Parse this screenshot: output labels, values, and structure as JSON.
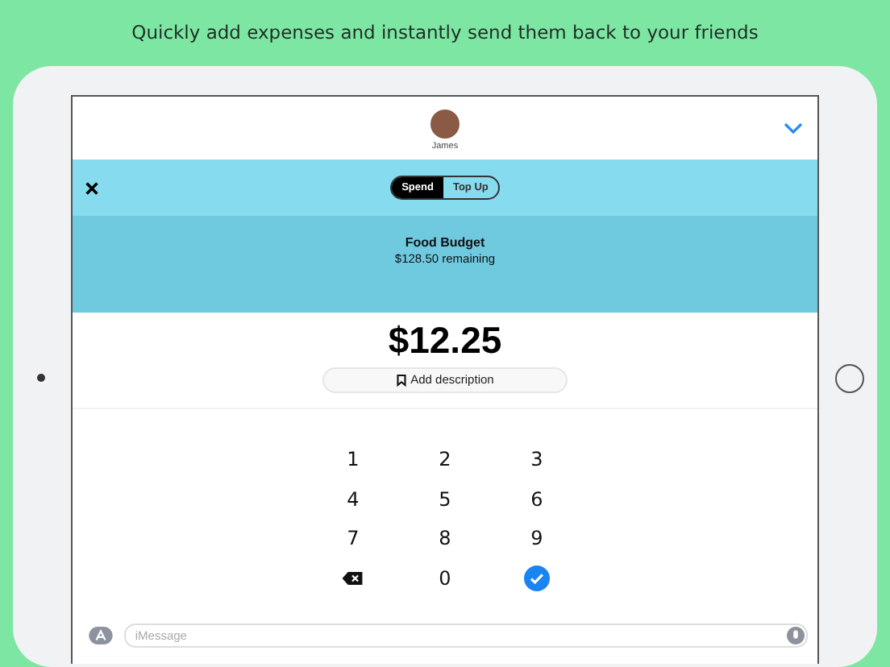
{
  "headline": "Quickly add expenses and instantly send them back to your friends",
  "contact": {
    "name": "James"
  },
  "segments": [
    {
      "label": "Spend",
      "selected": true
    },
    {
      "label": "Top Up",
      "selected": false
    }
  ],
  "budget": {
    "title": "Food Budget",
    "remaining": "$128.50 remaining"
  },
  "amount": "$12.25",
  "description": {
    "label": "Add description"
  },
  "keypad": [
    {
      "kind": "digit",
      "label": "1"
    },
    {
      "kind": "digit",
      "label": "2"
    },
    {
      "kind": "digit",
      "label": "3"
    },
    {
      "kind": "digit",
      "label": "4"
    },
    {
      "kind": "digit",
      "label": "5"
    },
    {
      "kind": "digit",
      "label": "6"
    },
    {
      "kind": "digit",
      "label": "7"
    },
    {
      "kind": "digit",
      "label": "8"
    },
    {
      "kind": "digit",
      "label": "9"
    },
    {
      "kind": "delete"
    },
    {
      "kind": "digit",
      "label": "0"
    },
    {
      "kind": "confirm"
    }
  ],
  "message_field": {
    "placeholder": "iMessage"
  }
}
